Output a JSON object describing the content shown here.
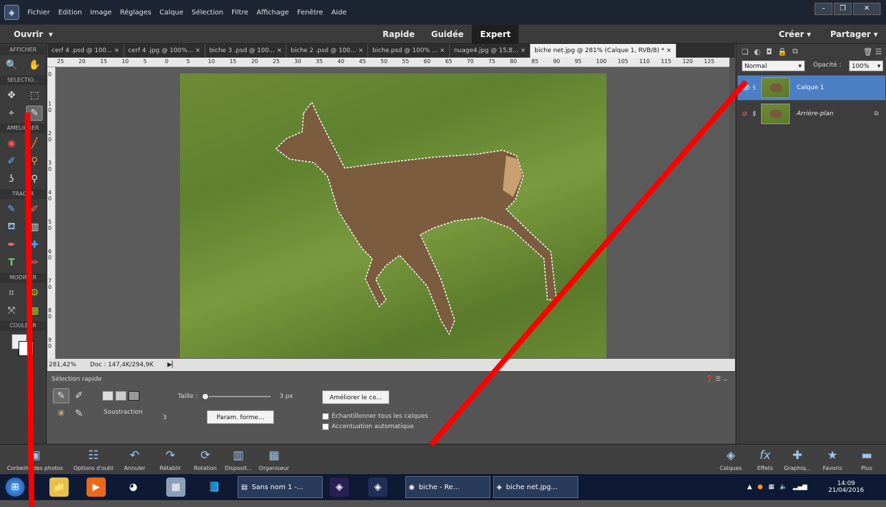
{
  "menu": [
    "Fichier",
    "Edition",
    "Image",
    "Réglages",
    "Calque",
    "Sélection",
    "Filtre",
    "Affichage",
    "Fenêtre",
    "Aide"
  ],
  "modebar": {
    "open": "Ouvrir",
    "open_arrow": "▾",
    "modes": [
      "Rapide",
      "Guidée",
      "Expert"
    ],
    "active_mode": "Expert",
    "create": "Créer ▾",
    "share": "Partager ▾"
  },
  "toolbox": {
    "sections": [
      "AFFICHER",
      "SELECTIO...",
      "AMELIORER",
      "TRACER",
      "MODIFIER",
      "COULEUR"
    ]
  },
  "tabs": [
    "cerf 4 .psd @ 100... ×",
    "cerf 4 .jpg @ 100%... ×",
    "biche 3 .psd @ 100... ×",
    "biche 2 .psd @ 100... ×",
    "biche.psd @ 100% ... ×",
    "nuage4.jpg @ 15,8... ×",
    "biche net.jpg @ 281% (Calque 1, RVB/8) * ×"
  ],
  "ruler": {
    "h": [
      "25",
      "20",
      "15",
      "10",
      "5",
      "0",
      "5",
      "10",
      "15",
      "20",
      "25",
      "30",
      "35",
      "40",
      "45",
      "50",
      "55",
      "60",
      "65",
      "70",
      "75",
      "80",
      "85",
      "90",
      "95",
      "100",
      "105",
      "110",
      "115",
      "120",
      "125"
    ],
    "v": [
      "0",
      "1\n0",
      "2\n0",
      "3\n0",
      "4\n0",
      "5\n0",
      "6\n0",
      "7\n0",
      "8\n0",
      "9\n0"
    ]
  },
  "status": {
    "zoom": "281,42%",
    "doc": "Doc : 147,4K/294,9K"
  },
  "options": {
    "tool_name": "Sélection rapide",
    "mode_label": "Soustraction",
    "size_label": "Taille :",
    "size_value": "3 px",
    "num": "3",
    "brush_btn": "Param. forme...",
    "refine_btn": "Améliorer le co...",
    "check1": "Echantillonner tous les calques",
    "check2": "Accentuation automatique"
  },
  "layers": {
    "blend": "Normal",
    "opacity_label": "Opacité :",
    "opacity": "100%",
    "items": [
      {
        "name": "Calque 1",
        "selected": true
      },
      {
        "name": "Arrière-plan",
        "selected": false
      }
    ]
  },
  "bottombar": {
    "left": [
      "Corbeille des photos",
      "Options d'outil",
      "Annuler",
      "Rétablir",
      "Rotation",
      "Disposit...",
      "Organiseur"
    ],
    "right": [
      "Calques",
      "Effets",
      "Graphiq...",
      "Favoris",
      "Plus"
    ]
  },
  "taskbar": {
    "windows": [
      "Sans nom 1 -...",
      "biche - Re...",
      "biche net.jpg..."
    ],
    "time": "14:09",
    "date": "21/04/2016"
  },
  "colors": {
    "accent": "#4d7fc4",
    "annotation": "#ff0000"
  }
}
